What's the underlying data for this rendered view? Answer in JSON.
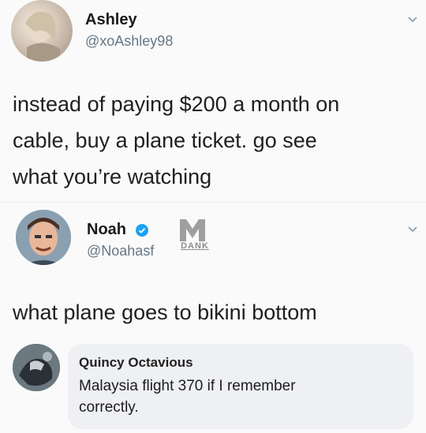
{
  "tweet1": {
    "name": "Ashley",
    "handle": "@xoAshley98",
    "text_line1": "instead of paying $200 a month on",
    "text_line2": "cable, buy a plane ticket. go see",
    "text_line3": "what you’re watching"
  },
  "tweet2": {
    "name": "Noah",
    "handle": "@Noahasf",
    "text": "what plane goes to bikini bottom",
    "watermark": "DANK"
  },
  "comment": {
    "name": "Quincy Octavious",
    "text_line1": "Malaysia flight 370 if I remember",
    "text_line2": "correctly."
  },
  "colors": {
    "verified": "#1da1f2",
    "handle": "#657786",
    "comment_bg": "#eef0f3"
  }
}
